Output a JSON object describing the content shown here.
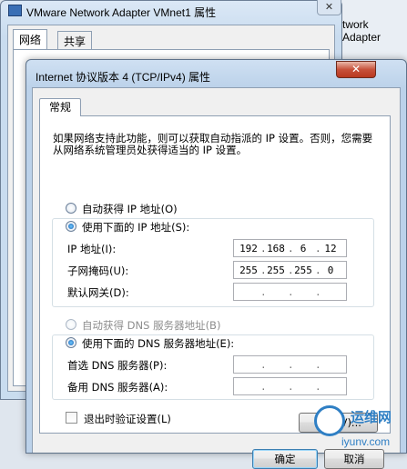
{
  "background_window": {
    "title": "VMware Network Adapter VMnet1 属性",
    "tabs": [
      "网络",
      "共享"
    ],
    "right_fragment": "twork Adapter"
  },
  "dialog": {
    "title": "Internet 协议版本 4 (TCP/IPv4) 属性",
    "close_label": "✕",
    "tab": "常规",
    "description": "如果网络支持此功能，则可以获取自动指派的 IP 设置。否则，您需要从网络系统管理员处获得适当的 IP 设置。",
    "ip_section": {
      "auto_label": "自动获得 IP 地址(O)",
      "manual_label": "使用下面的 IP 地址(S):",
      "fields": [
        {
          "label": "IP 地址(I):",
          "octets": [
            "192",
            "168",
            "6",
            "12"
          ]
        },
        {
          "label": "子网掩码(U):",
          "octets": [
            "255",
            "255",
            "255",
            "0"
          ]
        },
        {
          "label": "默认网关(D):",
          "octets": [
            "",
            "",
            "",
            ""
          ]
        }
      ]
    },
    "dns_section": {
      "auto_label": "自动获得 DNS 服务器地址(B)",
      "manual_label": "使用下面的 DNS 服务器地址(E):",
      "fields": [
        {
          "label": "首选 DNS 服务器(P):",
          "octets": [
            "",
            "",
            "",
            ""
          ]
        },
        {
          "label": "备用 DNS 服务器(A):",
          "octets": [
            "",
            "",
            "",
            ""
          ]
        }
      ]
    },
    "validate_label": "退出时验证设置(L)",
    "advanced_button": "高级(V)...",
    "ok_button": "确定",
    "cancel_button": "取消"
  },
  "watermark": {
    "title": "运维网",
    "url": "iyunv.com"
  }
}
